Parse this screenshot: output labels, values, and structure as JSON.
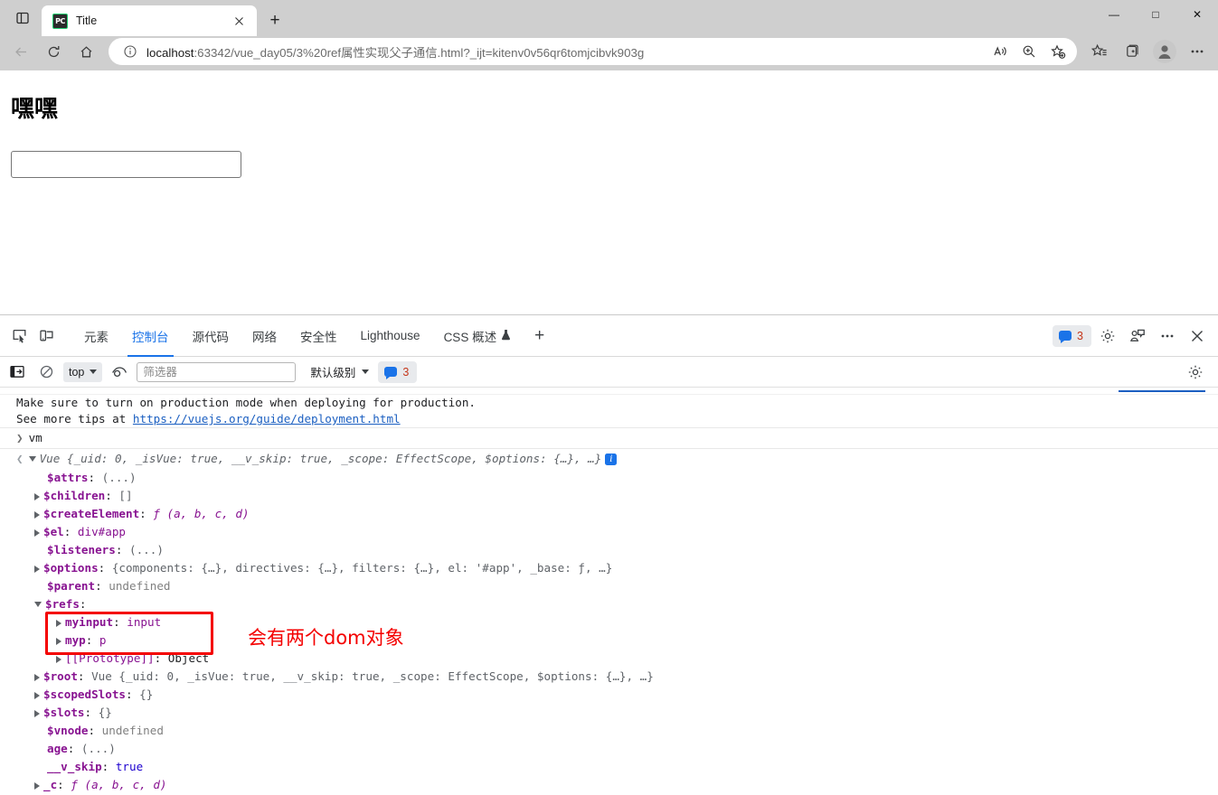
{
  "browser": {
    "tab": {
      "title": "Title",
      "favicon_label": "PC"
    },
    "new_tab_label": "+",
    "window_controls": {
      "minimize": "—",
      "maximize": "□",
      "close": "✕"
    },
    "omnibox": {
      "url_host": "localhost",
      "url_rest": ":63342/vue_day05/3%20ref属性实现父子通信.html?_ijt=kitenv0v56qr6tomjcibvk903g",
      "info_icon": "info-icon"
    },
    "toolbar_icons": [
      "back-icon",
      "refresh-icon",
      "home-icon"
    ],
    "omni_action_icons": [
      "read-aloud-icon",
      "zoom-icon",
      "add-favorite-icon",
      "favorites-icon",
      "collections-icon",
      "profile-avatar",
      "settings-more-icon"
    ]
  },
  "page": {
    "heading": "嘿嘿",
    "input_value": "",
    "input_placeholder": ""
  },
  "devtools": {
    "tabs": [
      {
        "label": "元素",
        "active": false
      },
      {
        "label": "控制台",
        "active": true
      },
      {
        "label": "源代码",
        "active": false
      },
      {
        "label": "网络",
        "active": false
      },
      {
        "label": "安全性",
        "active": false
      },
      {
        "label": "Lighthouse",
        "active": false
      },
      {
        "label": "CSS 概述",
        "active": false,
        "icon": "flask-icon"
      }
    ],
    "add_tab_label": "+",
    "message_count": "3",
    "right_icons": [
      "settings-gear-icon",
      "feedback-icon",
      "more-options-icon",
      "close-devtools-icon"
    ],
    "console_toolbar": {
      "sidebar_toggle": "console-sidebar-icon",
      "clear_label": "clear-console-icon",
      "context": "top",
      "eye_icon": "live-expression-icon",
      "filter_placeholder": "筛选器",
      "filter_value": "",
      "level": "默认级别",
      "level_badge": "3",
      "settings_icon": "console-settings-icon"
    },
    "console_rows": [
      {
        "type": "partial"
      },
      {
        "type": "text",
        "text": "Make sure to turn on production mode when deploying for production."
      },
      {
        "type": "link_line",
        "prefix": "See more tips at ",
        "link": "https://vuejs.org/guide/deployment.html"
      },
      {
        "type": "input",
        "text": "vm"
      },
      {
        "type": "vue_header",
        "text": "Vue {_uid: 0, _isVue: true, __v_skip: true, _scope: EffectScope, $options: {…}, …}"
      },
      {
        "type": "prop",
        "key": "$attrs",
        "value": "(...)",
        "expandable": false
      },
      {
        "type": "prop",
        "key": "$children",
        "value": "[]",
        "expandable": true
      },
      {
        "type": "prop",
        "key": "$createElement",
        "value": "ƒ (a, b, c, d)",
        "expandable": true
      },
      {
        "type": "prop",
        "key": "$el",
        "value": "div#app",
        "expandable": true
      },
      {
        "type": "prop",
        "key": "$listeners",
        "value": "(...)",
        "expandable": false
      },
      {
        "type": "prop",
        "key": "$options",
        "value": "{components: {…}, directives: {…}, filters: {…}, el: '#app', _base: ƒ, …}",
        "expandable": true
      },
      {
        "type": "prop",
        "key": "$parent",
        "value": "undefined",
        "expandable": false
      },
      {
        "type": "prop",
        "key": "$refs",
        "value": "",
        "expandable": true,
        "expanded": true
      },
      {
        "type": "prop2",
        "key": "myinput",
        "value": "input",
        "expandable": true
      },
      {
        "type": "prop2",
        "key": "myp",
        "value": "p",
        "expandable": true
      },
      {
        "type": "prop2",
        "key": "[[Prototype]]",
        "value": "Object",
        "expandable": true
      },
      {
        "type": "prop",
        "key": "$root",
        "value": "Vue {_uid: 0, _isVue: true, __v_skip: true, _scope: EffectScope, $options: {…}, …}",
        "expandable": true
      },
      {
        "type": "prop",
        "key": "$scopedSlots",
        "value": "{}",
        "expandable": true
      },
      {
        "type": "prop",
        "key": "$slots",
        "value": "{}",
        "expandable": true
      },
      {
        "type": "prop",
        "key": "$vnode",
        "value": "undefined",
        "expandable": false
      },
      {
        "type": "prop",
        "key": "age",
        "value": "(...)",
        "expandable": false
      },
      {
        "type": "prop",
        "key": "__v_skip",
        "value": "true",
        "expandable": false
      },
      {
        "type": "prop",
        "key": "_c",
        "value": "ƒ (a, b, c, d)",
        "expandable": true
      }
    ]
  },
  "annotation": {
    "note_text": "会有两个dom对象",
    "highlight_color": "#f40000"
  }
}
